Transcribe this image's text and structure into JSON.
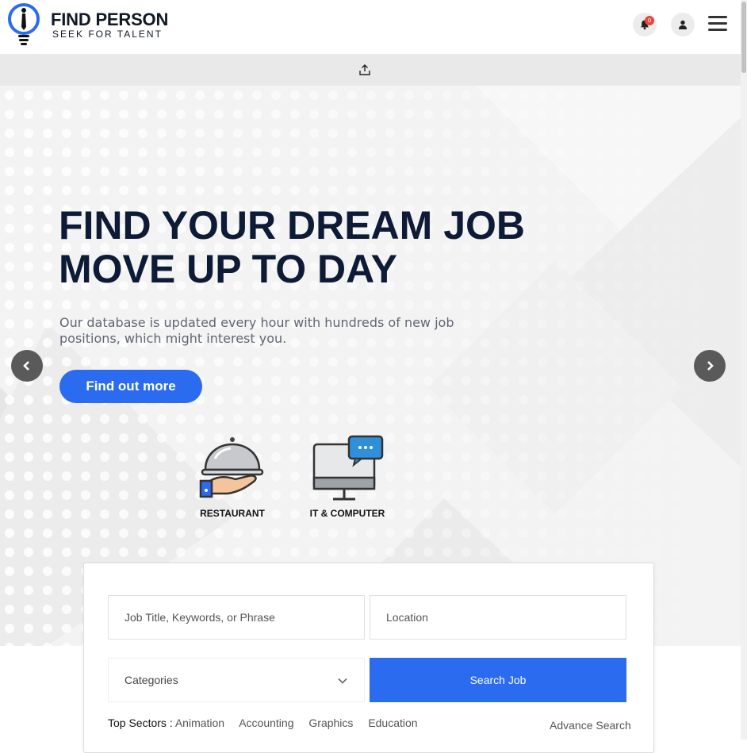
{
  "header": {
    "logo_title": "FIND PERSON",
    "logo_subtitle": "SEEK FOR TALENT",
    "notification_count": "0",
    "icons": {
      "logo": "lightbulb-tie-icon",
      "bell": "bell-icon",
      "user": "user-icon",
      "menu": "hamburger-menu-icon"
    }
  },
  "upload_bar": {
    "icon": "upload-icon"
  },
  "hero": {
    "title_line1": "FIND YOUR DREAM JOB",
    "title_line2": "MOVE UP TO DAY",
    "description": "Our database is updated every hour with hundreds of new job positions, which might interest you.",
    "cta_label": "Find out more",
    "categories": [
      {
        "label": "RESTAURANT",
        "icon": "food-cloche-icon"
      },
      {
        "label": "IT & COMPUTER",
        "icon": "computer-chat-icon"
      }
    ]
  },
  "search": {
    "job_placeholder": "Job Title, Keywords, or Phrase",
    "location_placeholder": "Location",
    "categories_label": "Categories",
    "search_button": "Search Job",
    "top_sectors_label": "Top Sectors :",
    "sectors": [
      "Animation",
      "Accounting",
      "Graphics",
      "Education"
    ],
    "advance_search": "Advance Search"
  },
  "colors": {
    "primary": "#2b6bf0",
    "dark_text": "#0d1b36",
    "badge": "#e8473a",
    "upload_bar": "#e9e9e9"
  }
}
